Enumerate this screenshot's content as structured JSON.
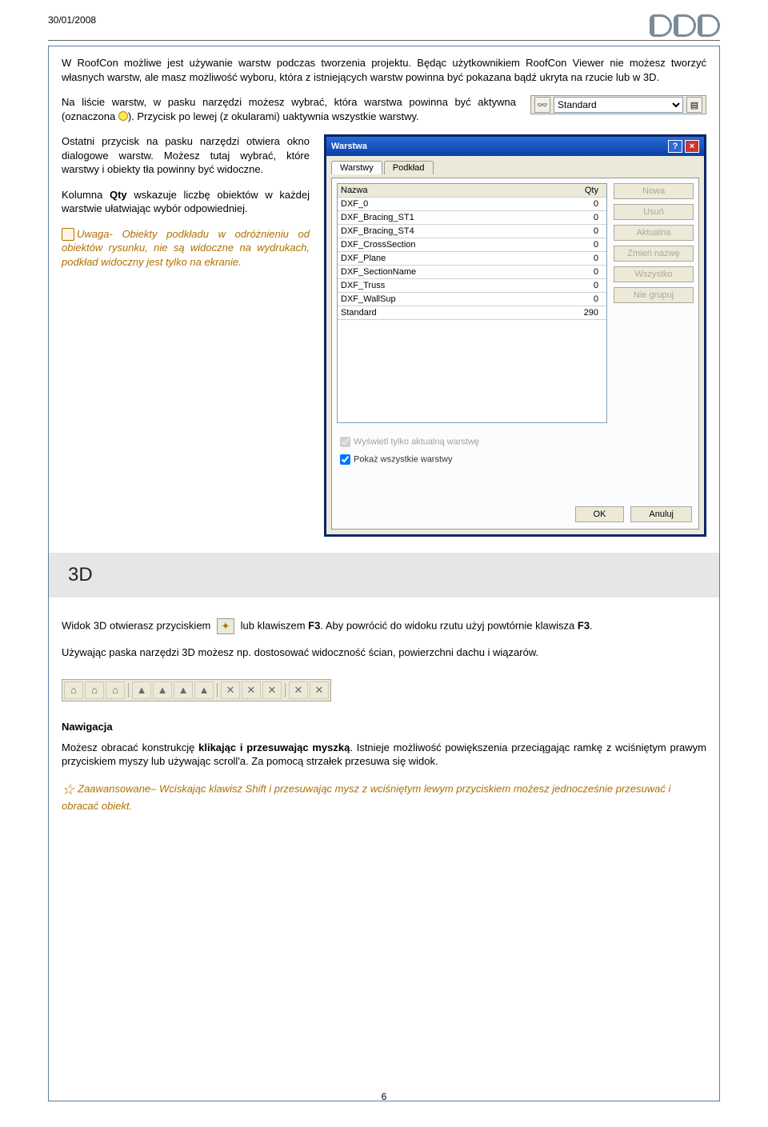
{
  "header": {
    "date": "30/01/2008"
  },
  "intro": {
    "p1": "W RoofCon możliwe jest używanie warstw podczas tworzenia projektu. Będąc użytkownikiem RoofCon Viewer nie możesz tworzyć własnych warstw, ale masz możliwość wyboru, która z istniejących warstw powinna być pokazana bądź ukryta na rzucie lub w 3D.",
    "p2a": "Na liście warstw, w pasku narzędzi możesz wybrać, która warstwa powinna być aktywna (oznaczona ",
    "p2b": "). Przycisk po lewej (z okularami) uaktywnia wszystkie warstwy.",
    "p3": "Ostatni przycisk na pasku narzędzi otwiera okno dialogowe warstw. Możesz tutaj wybrać, które warstwy i obiekty tła powinny być widoczne.",
    "p4a": "Kolumna ",
    "p4b": " wskazuje liczbę obiektów w każdej warstwie ułatwiając wybór odpowiedniej.",
    "qty": "Qty",
    "note": "Uwaga- Obiekty podkładu w odróżnieniu od obiektów rysunku, nie są widoczne na wydrukach, podkład widoczny jest tylko na ekranie."
  },
  "toolbar_select_value": "Standard",
  "dlg": {
    "title": "Warstwa",
    "tab1": "Warstwy",
    "tab2": "Podkład",
    "col_name": "Nazwa",
    "col_qty": "Qty",
    "rows": [
      {
        "name": "DXF_0",
        "qty": "0"
      },
      {
        "name": "DXF_Bracing_ST1",
        "qty": "0"
      },
      {
        "name": "DXF_Bracing_ST4",
        "qty": "0"
      },
      {
        "name": "DXF_CrossSection",
        "qty": "0"
      },
      {
        "name": "DXF_Plane",
        "qty": "0"
      },
      {
        "name": "DXF_SectionName",
        "qty": "0"
      },
      {
        "name": "DXF_Truss",
        "qty": "0"
      },
      {
        "name": "DXF_WallSup",
        "qty": "0"
      },
      {
        "name": "Standard",
        "qty": "290"
      }
    ],
    "sidebtns": [
      "Nowa",
      "Usuń",
      "Aktualna",
      "Zmień nazwę",
      "Wszystko",
      "Nie grupuj"
    ],
    "check1": "Wyświetl tylko aktualną warstwę",
    "check2": "Pokaż wszystkie warstwy",
    "ok": "OK",
    "cancel": "Anuluj"
  },
  "section3d": {
    "heading": "3D",
    "p1a": "Widok 3D otwierasz przyciskiem ",
    "p1b": " lub klawiszem ",
    "p1c": ". Aby powrócić do widoku rzutu użyj powtórnie klawisza ",
    "p1d": ".",
    "f3": "F3",
    "p2": "Używając paska narzędzi 3D możesz np. dostosować widoczność ścian, powierzchni dachu i wiązarów."
  },
  "nav": {
    "heading": "Nawigacja",
    "p1a": "Możesz obracać konstrukcję ",
    "p1b": "klikając i przesuwając myszką",
    "p1c": ". Istnieje możliwość powiększenia przeciągając ramkę z wciśniętym prawym przyciskiem myszy lub używając scroll'a. Za pomocą strzałek przesuwa się widok.",
    "adv": "Zaawansowane– Wciskając klawisz Shift i przesuwając mysz z wciśniętym lewym przyciskiem możesz jednocześnie przesuwać i obracać obiekt."
  },
  "page_number": "6"
}
